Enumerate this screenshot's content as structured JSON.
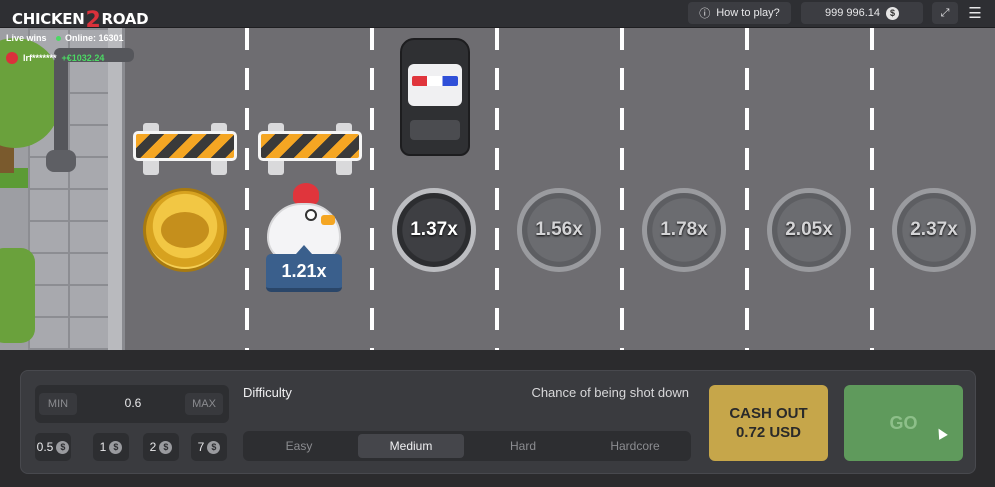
{
  "header": {
    "logo_text_left": "CHICKEN",
    "logo_text_mid": "2",
    "logo_text_right": "ROAD",
    "how_to_play": "How to play?",
    "balance": "999 996.14",
    "currency_symbol": "$",
    "info_icon": "info-icon",
    "fullscreen_icon": "fullscreen-icon",
    "menu_icon": "menu-icon"
  },
  "live": {
    "label": "Live wins",
    "online": "Online: 16301",
    "user": "lrf*******",
    "amount": "+€1032.24"
  },
  "road": {
    "current_multiplier": "1.21x",
    "multipliers": [
      "1.37x",
      "1.56x",
      "1.78x",
      "2.05x",
      "2.37x"
    ]
  },
  "controls": {
    "bet_min": "MIN",
    "bet_value": "0.6",
    "bet_max": "MAX",
    "chips": [
      "0.5",
      "1",
      "2",
      "7"
    ],
    "chip_symbol": "$",
    "difficulty_label": "Difficulty",
    "chance_label": "Chance of being shot down",
    "difficulty_options": [
      "Easy",
      "Medium",
      "Hard",
      "Hardcore"
    ],
    "selected_difficulty": "Medium",
    "cashout_line1": "CASH OUT",
    "cashout_line2": "0.72 USD",
    "go_label": "GO"
  },
  "colors": {
    "cashout": "#c6a64a",
    "go": "#5f9a5c",
    "multiplier_tag": "#3a5f8c",
    "road": "#6e6d71"
  }
}
